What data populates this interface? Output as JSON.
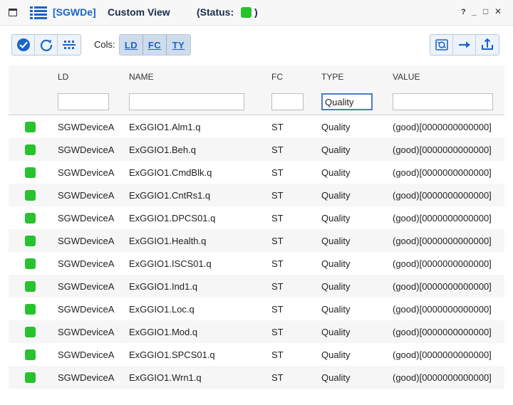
{
  "window": {
    "tag": "[SGWDe]",
    "name": "Custom View",
    "status_label": "(Status:",
    "status_close": ")",
    "status_color": "#27c22d",
    "controls": {
      "help": "?",
      "minimize": "_",
      "maximize": "□",
      "close": "✕"
    }
  },
  "toolbar": {
    "cols_label": "Cols:",
    "left_icons": [
      "check-circle-icon",
      "refresh-icon",
      "network-icon"
    ],
    "col_buttons": [
      "LD",
      "FC",
      "TY"
    ],
    "right_icons": [
      "export-icon",
      "arrow-right-icon",
      "anchor-icon"
    ]
  },
  "table": {
    "headers": {
      "ld": "LD",
      "name": "NAME",
      "fc": "FC",
      "type": "TYPE",
      "value": "VALUE"
    },
    "filters": {
      "ld": "",
      "name": "",
      "fc": "",
      "type": "Quality",
      "value": ""
    },
    "rows": [
      {
        "ld": "SGWDeviceA",
        "name": "ExGGIO1.Alm1.q",
        "fc": "ST",
        "type": "Quality",
        "value": "(good)[0000000000000]"
      },
      {
        "ld": "SGWDeviceA",
        "name": "ExGGIO1.Beh.q",
        "fc": "ST",
        "type": "Quality",
        "value": "(good)[0000000000000]"
      },
      {
        "ld": "SGWDeviceA",
        "name": "ExGGIO1.CmdBlk.q",
        "fc": "ST",
        "type": "Quality",
        "value": "(good)[0000000000000]"
      },
      {
        "ld": "SGWDeviceA",
        "name": "ExGGIO1.CntRs1.q",
        "fc": "ST",
        "type": "Quality",
        "value": "(good)[0000000000000]"
      },
      {
        "ld": "SGWDeviceA",
        "name": "ExGGIO1.DPCS01.q",
        "fc": "ST",
        "type": "Quality",
        "value": "(good)[0000000000000]"
      },
      {
        "ld": "SGWDeviceA",
        "name": "ExGGIO1.Health.q",
        "fc": "ST",
        "type": "Quality",
        "value": "(good)[0000000000000]"
      },
      {
        "ld": "SGWDeviceA",
        "name": "ExGGIO1.ISCS01.q",
        "fc": "ST",
        "type": "Quality",
        "value": "(good)[0000000000000]"
      },
      {
        "ld": "SGWDeviceA",
        "name": "ExGGIO1.Ind1.q",
        "fc": "ST",
        "type": "Quality",
        "value": "(good)[0000000000000]"
      },
      {
        "ld": "SGWDeviceA",
        "name": "ExGGIO1.Loc.q",
        "fc": "ST",
        "type": "Quality",
        "value": "(good)[0000000000000]"
      },
      {
        "ld": "SGWDeviceA",
        "name": "ExGGIO1.Mod.q",
        "fc": "ST",
        "type": "Quality",
        "value": "(good)[0000000000000]"
      },
      {
        "ld": "SGWDeviceA",
        "name": "ExGGIO1.SPCS01.q",
        "fc": "ST",
        "type": "Quality",
        "value": "(good)[0000000000000]"
      },
      {
        "ld": "SGWDeviceA",
        "name": "ExGGIO1.Wrn1.q",
        "fc": "ST",
        "type": "Quality",
        "value": "(good)[0000000000000]"
      }
    ],
    "row_status_color": "#27c22d"
  }
}
